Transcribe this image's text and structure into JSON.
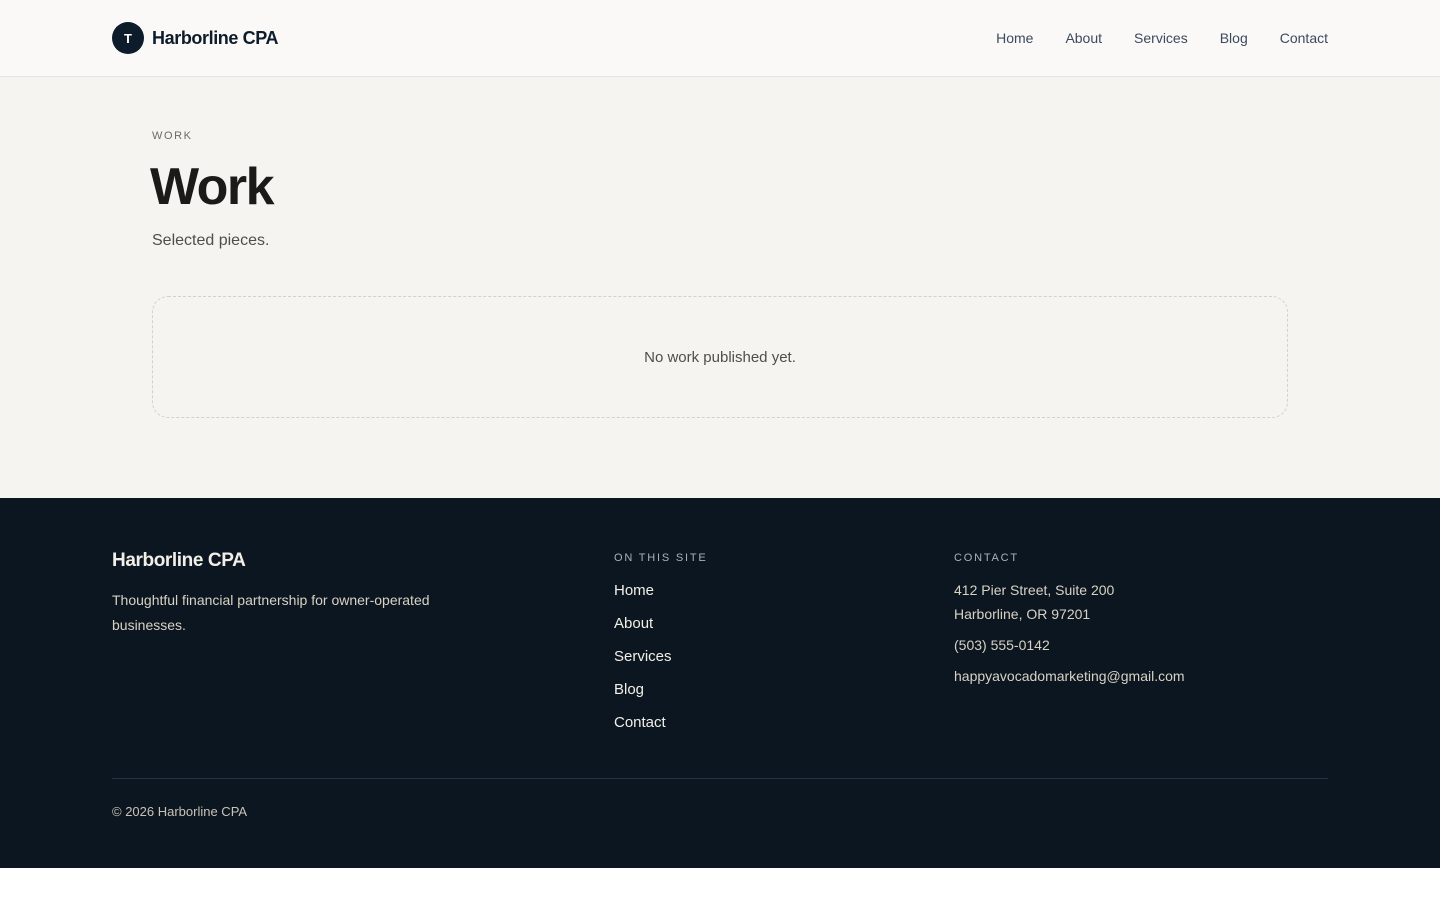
{
  "header": {
    "logo_letter": "T",
    "brand_name": "Harborline CPA",
    "nav": [
      "Home",
      "About",
      "Services",
      "Blog",
      "Contact"
    ]
  },
  "main": {
    "eyebrow": "WORK",
    "title": "Work",
    "subtitle": "Selected pieces.",
    "empty_state": "No work published yet."
  },
  "footer": {
    "brand_name": "Harborline CPA",
    "tagline": "Thoughtful financial partnership for owner-operated businesses.",
    "links_title": "ON THIS SITE",
    "links": [
      "Home",
      "About",
      "Services",
      "Blog",
      "Contact"
    ],
    "contact_title": "CONTACT",
    "address_line1": "412 Pier Street, Suite 200",
    "address_line2": "Harborline, OR 97201",
    "phone": "(503) 555-0142",
    "email": "happyavocadomarketing@gmail.com",
    "copyright": "© 2026 Harborline CPA"
  },
  "colors": {
    "navy": "#0d1b2a",
    "footer_bg": "#0c1621",
    "page_bg": "#f5f4f1"
  }
}
